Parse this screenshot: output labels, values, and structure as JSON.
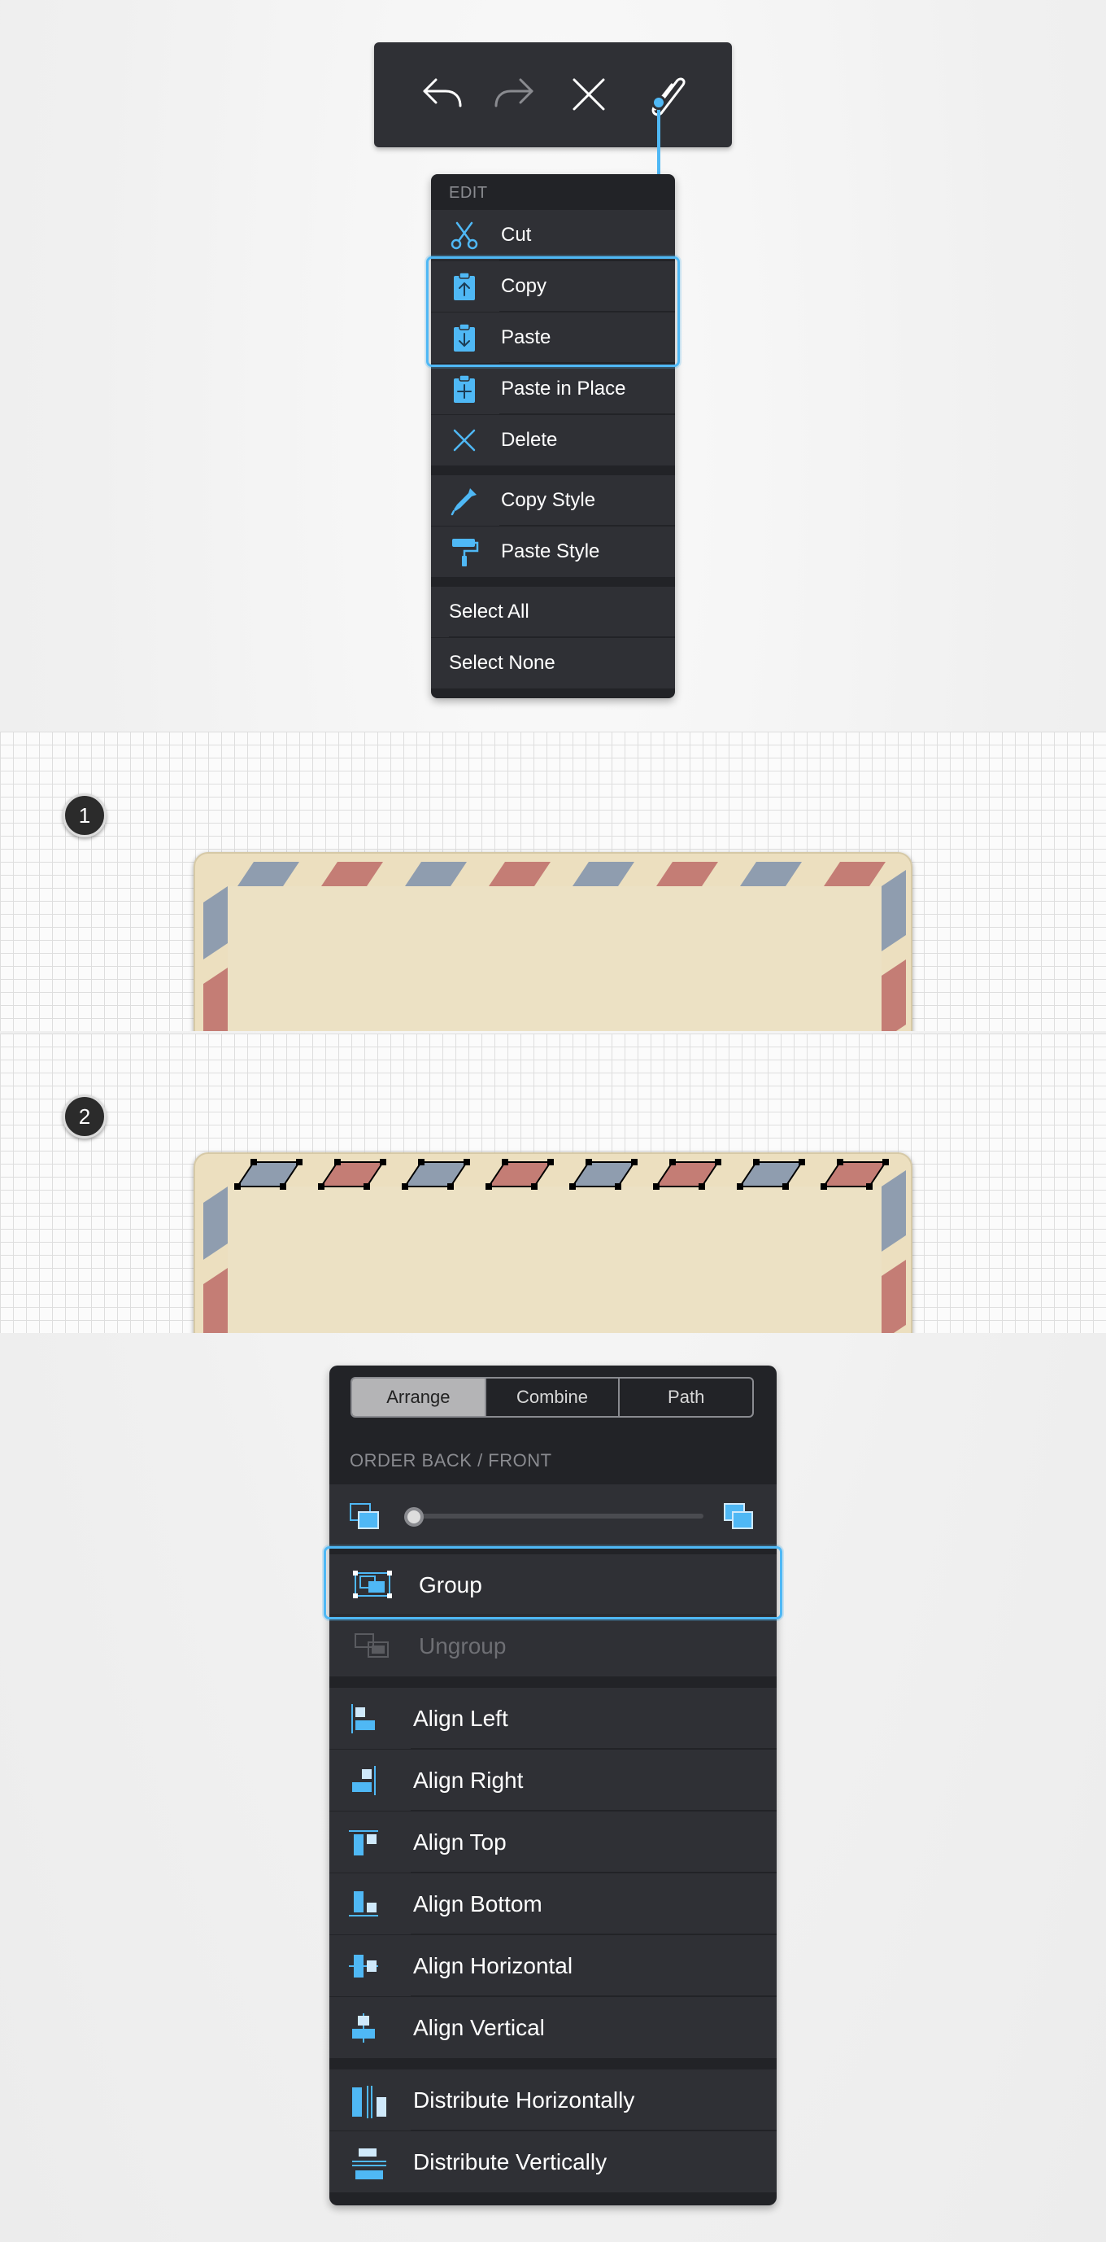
{
  "edit_menu": {
    "header": "EDIT",
    "items": [
      {
        "label": "Cut",
        "icon": "scissors-icon"
      },
      {
        "label": "Copy",
        "icon": "clipboard-copy-icon"
      },
      {
        "label": "Paste",
        "icon": "clipboard-paste-icon"
      },
      {
        "label": "Paste in Place",
        "icon": "clipboard-paste-in-place-icon"
      },
      {
        "label": "Delete",
        "icon": "delete-x-icon"
      },
      {
        "label": "Copy Style",
        "icon": "eyedropper-icon"
      },
      {
        "label": "Paste Style",
        "icon": "paint-roller-icon"
      },
      {
        "label": "Select All"
      },
      {
        "label": "Select None"
      }
    ]
  },
  "toolbar": {
    "icons": [
      "undo-icon",
      "redo-icon",
      "close-icon",
      "paperclip-icon"
    ]
  },
  "steps": [
    {
      "number": "1"
    },
    {
      "number": "2"
    }
  ],
  "arrange_panel": {
    "tabs": [
      "Arrange",
      "Combine",
      "Path"
    ],
    "active_tab": "Arrange",
    "order_label": "ORDER BACK / FRONT",
    "slider_value": 0,
    "group_items": [
      {
        "label": "Group",
        "enabled": true
      },
      {
        "label": "Ungroup",
        "enabled": false
      }
    ],
    "align_items": [
      {
        "label": "Align Left"
      },
      {
        "label": "Align Right"
      },
      {
        "label": "Align Top"
      },
      {
        "label": "Align Bottom"
      },
      {
        "label": "Align Horizontal"
      },
      {
        "label": "Align Vertical"
      }
    ],
    "distribute_items": [
      {
        "label": "Distribute Horizontally"
      },
      {
        "label": "Distribute Vertically"
      }
    ]
  },
  "colors": {
    "accent": "#4fb8f5",
    "panel": "#2f3035",
    "panel_dark": "#222327",
    "stripe_blue": "#8f9daf",
    "stripe_red": "#c47d75",
    "envelope": "#ecdfbf"
  }
}
